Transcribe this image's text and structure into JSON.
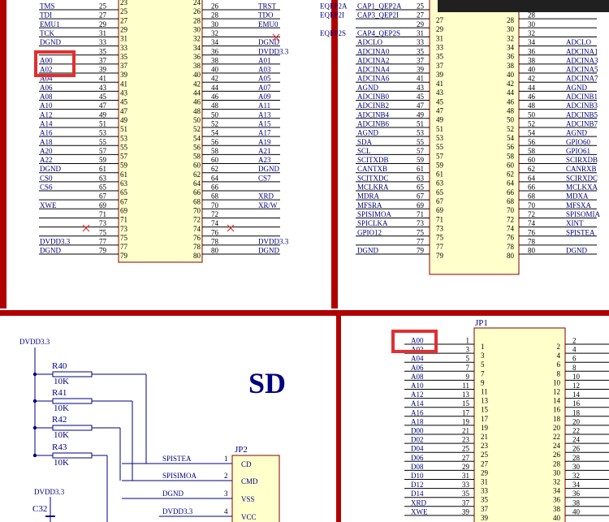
{
  "colors": {
    "net": "#000080",
    "border": "#b00000",
    "body_fill": "#ffffcc",
    "highlight": "#e03030",
    "no_connect": "#e03030"
  },
  "sd_title": "SD",
  "top_left": {
    "rows": [
      {
        "ln": "TMS",
        "lp": "25",
        "rp": "26",
        "rn": "TRST"
      },
      {
        "ln": "TDI",
        "lp": "27",
        "rp": "28",
        "rn": "TDO"
      },
      {
        "ln": "EMU1",
        "lp": "29",
        "rp": "30",
        "rn": "EMU0"
      },
      {
        "ln": "TCK",
        "lp": "31",
        "rp": "32",
        "rn": ""
      },
      {
        "ln": "DGND",
        "lp": "33",
        "rp": "34",
        "rn": "DGND"
      },
      {
        "ln": "",
        "lp": "35",
        "rp": "36",
        "rn": "DVDD3.3"
      },
      {
        "ln": "A00",
        "lp": "37",
        "rp": "38",
        "rn": "A01"
      },
      {
        "ln": "A02",
        "lp": "39",
        "rp": "40",
        "rn": "A03"
      },
      {
        "ln": "A04",
        "lp": "41",
        "rp": "42",
        "rn": "A05"
      },
      {
        "ln": "A06",
        "lp": "43",
        "rp": "44",
        "rn": "A07"
      },
      {
        "ln": "A08",
        "lp": "45",
        "rp": "46",
        "rn": "A09"
      },
      {
        "ln": "A10",
        "lp": "47",
        "rp": "48",
        "rn": "A11"
      },
      {
        "ln": "A12",
        "lp": "49",
        "rp": "50",
        "rn": "A13"
      },
      {
        "ln": "A14",
        "lp": "51",
        "rp": "52",
        "rn": "A15"
      },
      {
        "ln": "A16",
        "lp": "53",
        "rp": "54",
        "rn": "A17"
      },
      {
        "ln": "A18",
        "lp": "55",
        "rp": "56",
        "rn": "A19"
      },
      {
        "ln": "A20",
        "lp": "57",
        "rp": "58",
        "rn": "A21"
      },
      {
        "ln": "A22",
        "lp": "59",
        "rp": "60",
        "rn": "A23"
      },
      {
        "ln": "DGND",
        "lp": "61",
        "rp": "62",
        "rn": "DGND"
      },
      {
        "ln": "CS0",
        "lp": "63",
        "rp": "64",
        "rn": "CS7"
      },
      {
        "ln": "CS6",
        "lp": "65",
        "rp": "66",
        "rn": ""
      },
      {
        "ln": "",
        "lp": "67",
        "rp": "68",
        "rn": "XRD"
      },
      {
        "ln": "XWE",
        "lp": "69",
        "rp": "70",
        "rn": "XR/W"
      },
      {
        "ln": "",
        "lp": "71",
        "rp": "72",
        "rn": ""
      },
      {
        "ln": "",
        "lp": "73",
        "rp": "74",
        "rn": ""
      },
      {
        "ln": "",
        "lp": "75",
        "rp": "76",
        "rn": ""
      },
      {
        "ln": "DVDD3.3",
        "lp": "77",
        "rp": "78",
        "rn": "DVDD3.3"
      },
      {
        "ln": "DGND",
        "lp": "79",
        "rp": "80",
        "rn": "DGND"
      }
    ],
    "inner_left": [
      "23",
      "25",
      "27",
      "29",
      "31",
      "33",
      "35",
      "37",
      "39",
      "41",
      "43",
      "45",
      "47",
      "49",
      "51",
      "53",
      "55",
      "57",
      "59",
      "61",
      "63",
      "65",
      "67",
      "69",
      "71",
      "73",
      "75",
      "77",
      "79"
    ],
    "inner_right": [
      "24",
      "26",
      "28",
      "30",
      "32",
      "34",
      "36",
      "38",
      "40",
      "42",
      "44",
      "46",
      "48",
      "50",
      "52",
      "54",
      "56",
      "58",
      "60",
      "62",
      "64",
      "66",
      "68",
      "70",
      "72",
      "74",
      "76",
      "78",
      "80"
    ]
  },
  "top_right": {
    "eqep": [
      "EQEP2A",
      "EQEP2I",
      "",
      "EQEP2S"
    ],
    "rows": [
      {
        "ln": "CAP1_QEP2A",
        "lp": "25",
        "rp": "",
        "rn": ""
      },
      {
        "ln": "CAP3_QEP2I",
        "lp": "27",
        "rp": "28",
        "rn": ""
      },
      {
        "ln": "",
        "lp": "29",
        "rp": "30",
        "rn": ""
      },
      {
        "ln": "CAP4_QEP2S",
        "lp": "31",
        "rp": "32",
        "rn": ""
      },
      {
        "ln": "ADCLO",
        "lp": "33",
        "rp": "34",
        "rn": "ADCLO"
      },
      {
        "ln": "ADCINA0",
        "lp": "35",
        "rp": "36",
        "rn": "ADCINA1"
      },
      {
        "ln": "ADCINA2",
        "lp": "37",
        "rp": "38",
        "rn": "ADCINA3"
      },
      {
        "ln": "ADCINA4",
        "lp": "39",
        "rp": "40",
        "rn": "ADCINA5"
      },
      {
        "ln": "ADCINA6",
        "lp": "41",
        "rp": "42",
        "rn": "ADCINA7"
      },
      {
        "ln": "AGND",
        "lp": "43",
        "rp": "44",
        "rn": "AGND"
      },
      {
        "ln": "ADCINB0",
        "lp": "45",
        "rp": "46",
        "rn": "ADCINB1"
      },
      {
        "ln": "ADCINB2",
        "lp": "47",
        "rp": "48",
        "rn": "ADCINB3"
      },
      {
        "ln": "ADCINB4",
        "lp": "49",
        "rp": "50",
        "rn": "ADCINB5"
      },
      {
        "ln": "ADCINB6",
        "lp": "51",
        "rp": "52",
        "rn": "ADCINB7"
      },
      {
        "ln": "AGND",
        "lp": "53",
        "rp": "54",
        "rn": "AGND"
      },
      {
        "ln": "SDA",
        "lp": "55",
        "rp": "56",
        "rn": "GPIO60"
      },
      {
        "ln": "SCL",
        "lp": "57",
        "rp": "58",
        "rn": "GPIO61"
      },
      {
        "ln": "SCITXDB",
        "lp": "59",
        "rp": "60",
        "rn": "SCIRXDB"
      },
      {
        "ln": "CANTXB",
        "lp": "61",
        "rp": "62",
        "rn": "CANRXB"
      },
      {
        "ln": "SCITXDC",
        "lp": "63",
        "rp": "64",
        "rn": "SCIRXDC"
      },
      {
        "ln": "MCLKRA",
        "lp": "65",
        "rp": "66",
        "rn": "MCLKXA"
      },
      {
        "ln": "MDRA",
        "lp": "67",
        "rp": "68",
        "rn": "MDXA"
      },
      {
        "ln": "MFSRA",
        "lp": "69",
        "rp": "70",
        "rn": "MFSXA"
      },
      {
        "ln": "SPISIMOA",
        "lp": "71",
        "rp": "72",
        "rn": "SPISOMIA"
      },
      {
        "ln": "SPICLKA",
        "lp": "73",
        "rp": "74",
        "rn": "XINT"
      },
      {
        "ln": "GPIO12",
        "lp": "75",
        "rp": "76",
        "rn": "SPISTEA"
      },
      {
        "ln": "",
        "lp": "77",
        "rp": "78",
        "rn": ""
      },
      {
        "ln": "DGND",
        "lp": "79",
        "rp": "80",
        "rn": "DGND"
      }
    ],
    "inner_left": [
      "27",
      "29",
      "31",
      "33",
      "35",
      "37",
      "39",
      "41",
      "43",
      "45",
      "47",
      "49",
      "51",
      "53",
      "55",
      "57",
      "59",
      "61",
      "63",
      "65",
      "67",
      "69",
      "71",
      "73",
      "75",
      "77",
      "79"
    ],
    "inner_right": [
      "28",
      "30",
      "32",
      "34",
      "36",
      "38",
      "40",
      "42",
      "44",
      "46",
      "48",
      "50",
      "52",
      "54",
      "56",
      "58",
      "60",
      "62",
      "64",
      "66",
      "68",
      "70",
      "72",
      "74",
      "76",
      "78",
      "80"
    ]
  },
  "sd_section": {
    "supply": "DVDD3.3",
    "resistors": [
      {
        "ref": "R40",
        "value": "10K"
      },
      {
        "ref": "R41",
        "value": "10K"
      },
      {
        "ref": "R42",
        "value": "10K"
      },
      {
        "ref": "R43",
        "value": "10K"
      }
    ],
    "jp2": {
      "ref": "JP2",
      "pins": [
        {
          "net": "SPISTEA",
          "num": "1",
          "name": "CD"
        },
        {
          "net": "SPISIMOA",
          "num": "2",
          "name": "CMD"
        },
        {
          "net": "DGND",
          "num": "3",
          "name": "VSS"
        },
        {
          "net": "DVDD3.3",
          "num": "4",
          "name": "VCC"
        }
      ]
    },
    "cap_supply": "DVDD3.3",
    "cap_ref": "C32"
  },
  "jp1": {
    "ref": "JP1",
    "rows": [
      {
        "net": "A00",
        "on": "1",
        "in": "1",
        "ir": "2",
        "rn": "2"
      },
      {
        "net": "A02",
        "on": "3",
        "in": "3",
        "ir": "4",
        "rn": "4"
      },
      {
        "net": "A04",
        "on": "5",
        "in": "5",
        "ir": "6",
        "rn": "6"
      },
      {
        "net": "A06",
        "on": "7",
        "in": "7",
        "ir": "8",
        "rn": "8"
      },
      {
        "net": "A08",
        "on": "9",
        "in": "9",
        "ir": "10",
        "rn": "10"
      },
      {
        "net": "A10",
        "on": "11",
        "in": "11",
        "ir": "12",
        "rn": "12"
      },
      {
        "net": "A12",
        "on": "13",
        "in": "13",
        "ir": "14",
        "rn": "14"
      },
      {
        "net": "A14",
        "on": "15",
        "in": "15",
        "ir": "16",
        "rn": "16"
      },
      {
        "net": "A16",
        "on": "17",
        "in": "17",
        "ir": "18",
        "rn": "18"
      },
      {
        "net": "A18",
        "on": "19",
        "in": "19",
        "ir": "20",
        "rn": "20"
      },
      {
        "net": "D00",
        "on": "21",
        "in": "21",
        "ir": "22",
        "rn": "22"
      },
      {
        "net": "D02",
        "on": "23",
        "in": "23",
        "ir": "24",
        "rn": "24"
      },
      {
        "net": "D04",
        "on": "25",
        "in": "25",
        "ir": "26",
        "rn": "26"
      },
      {
        "net": "D06",
        "on": "27",
        "in": "27",
        "ir": "28",
        "rn": "28"
      },
      {
        "net": "D08",
        "on": "29",
        "in": "29",
        "ir": "30",
        "rn": "30"
      },
      {
        "net": "D10",
        "on": "31",
        "in": "31",
        "ir": "32",
        "rn": "32"
      },
      {
        "net": "D12",
        "on": "33",
        "in": "33",
        "ir": "34",
        "rn": "34"
      },
      {
        "net": "D14",
        "on": "35",
        "in": "35",
        "ir": "36",
        "rn": "36"
      },
      {
        "net": "XRD",
        "on": "37",
        "in": "37",
        "ir": "38",
        "rn": "38"
      },
      {
        "net": "XWE",
        "on": "39",
        "in": "39",
        "ir": "40",
        "rn": "40"
      }
    ]
  }
}
